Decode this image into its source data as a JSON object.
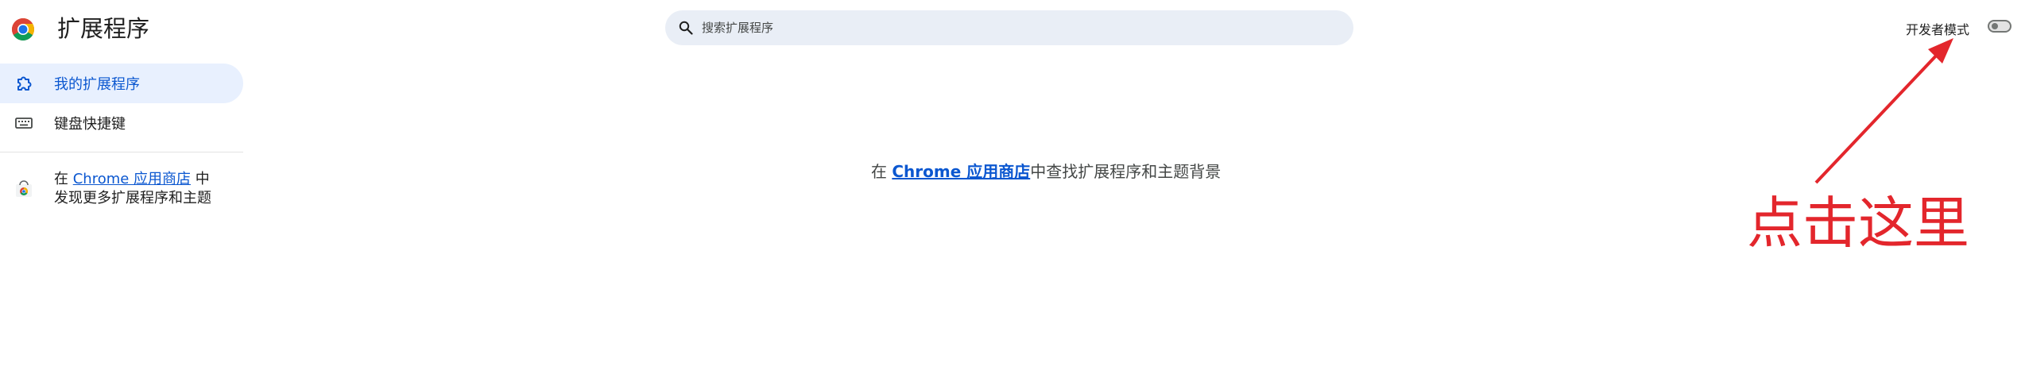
{
  "header": {
    "title": "扩展程序",
    "search_placeholder": "搜索扩展程序",
    "dev_mode_label": "开发者模式",
    "dev_mode_enabled": false
  },
  "sidebar": {
    "items": [
      {
        "label": "我的扩展程序",
        "icon": "extension-puzzle-icon",
        "active": true
      },
      {
        "label": "键盘快捷键",
        "icon": "keyboard-icon",
        "active": false
      }
    ],
    "store_promo": {
      "prefix": "在 ",
      "link": "Chrome 应用商店",
      "suffix": " 中发现更多扩展程序和主题"
    }
  },
  "main": {
    "empty_prefix": "在 ",
    "empty_link": "Chrome 应用商店",
    "empty_suffix": "中查找扩展程序和主题背景"
  },
  "annotation": {
    "text": "点击这里",
    "color": "#e3262c"
  },
  "colors": {
    "accent": "#0b57d0",
    "active_nav_bg": "#e8f0fe",
    "search_bg": "#e9eef6"
  }
}
